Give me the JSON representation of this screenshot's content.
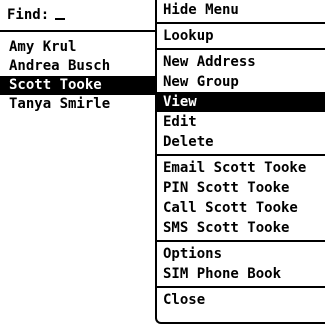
{
  "find": {
    "label": "Find:"
  },
  "contacts": [
    {
      "name": "Amy Krul",
      "selected": false
    },
    {
      "name": "Andrea Busch",
      "selected": false
    },
    {
      "name": "Scott Tooke",
      "selected": true
    },
    {
      "name": "Tanya Smirle",
      "selected": false
    }
  ],
  "menu": {
    "groups": [
      [
        {
          "label": "Hide Menu"
        }
      ],
      [
        {
          "label": "Lookup"
        }
      ],
      [
        {
          "label": "New Address"
        },
        {
          "label": "New Group"
        },
        {
          "label": "View",
          "selected": true
        },
        {
          "label": "Edit"
        },
        {
          "label": "Delete"
        }
      ],
      [
        {
          "label": "Email Scott Tooke"
        },
        {
          "label": "PIN Scott Tooke"
        },
        {
          "label": "Call Scott Tooke"
        },
        {
          "label": "SMS Scott Tooke"
        }
      ],
      [
        {
          "label": "Options"
        },
        {
          "label": "SIM Phone Book"
        }
      ],
      [
        {
          "label": "Close"
        }
      ]
    ]
  },
  "colors": {
    "background": "#ffffff",
    "foreground": "#000000",
    "selection": "#000000"
  }
}
